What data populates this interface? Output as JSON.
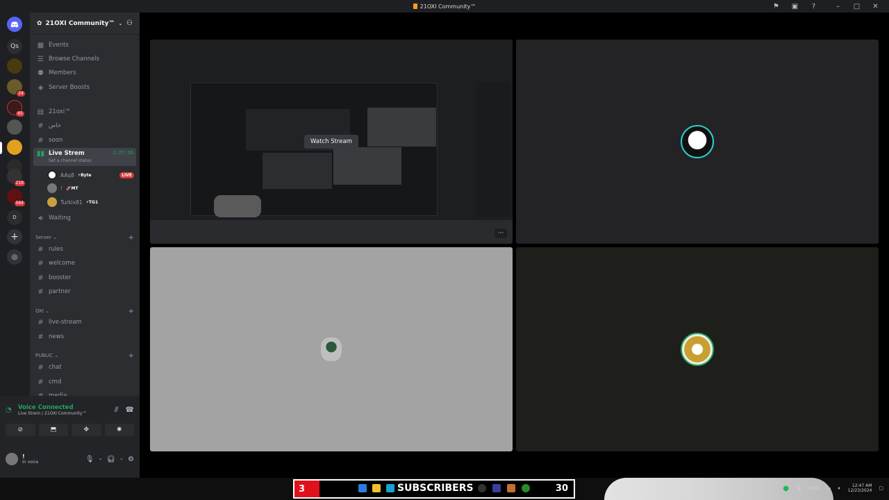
{
  "window": {
    "title": "21OXI Community™",
    "controls": [
      "flag-icon",
      "inbox-icon",
      "help-icon",
      "minimize-icon",
      "maximize-icon",
      "close-icon"
    ]
  },
  "guilds": {
    "home_label": "",
    "items": [
      {
        "label": "Qs",
        "badge": ""
      },
      {
        "label": "",
        "badge": ""
      },
      {
        "label": "",
        "badge": "24"
      },
      {
        "label": "",
        "badge": "65"
      },
      {
        "label": "",
        "badge": ""
      },
      {
        "label": "",
        "badge": ""
      },
      {
        "label": "",
        "badge": ""
      },
      {
        "label": "",
        "badge": "219"
      },
      {
        "label": "",
        "badge": "564"
      },
      {
        "label": "",
        "badge": "D"
      }
    ]
  },
  "server": {
    "name": "21OXI Community™",
    "menu": [
      {
        "label": "Events"
      },
      {
        "label": "Browse Channels"
      },
      {
        "label": "Members"
      },
      {
        "label": "Server Boosts"
      }
    ],
    "channels_top": [
      {
        "label": "21oxi™"
      },
      {
        "label": "خاص"
      },
      {
        "label": "soon"
      }
    ],
    "live_channel": {
      "label": "Live Strem",
      "timer": "2:27:16",
      "status": "Set a channel status"
    },
    "voice_users": [
      {
        "name": "AAq8",
        "tag": "Byte",
        "live": "LIVE"
      },
      {
        "name": "!",
        "tag": "MT",
        "live": ""
      },
      {
        "name": "Turkix81",
        "tag": "TG1",
        "live": ""
      }
    ],
    "waiting": "Waiting",
    "categories": [
      {
        "name": "Server",
        "channels": [
          "rules",
          "welcome",
          "booster",
          "partner"
        ]
      },
      {
        "name": "OXI",
        "channels": [
          "live-stream",
          "news"
        ]
      },
      {
        "name": "PUBLIC",
        "channels": [
          "chat",
          "cmd",
          "media"
        ]
      }
    ]
  },
  "voice_panel": {
    "status": "Voice Connected",
    "location": "Live Strem / 21OXI Community™",
    "user_name": "!",
    "user_status": "In voice"
  },
  "stage": {
    "watch_button": "Watch Stream",
    "more": "···"
  },
  "taskbar": {
    "sub_count": "3",
    "sub_label": "SUBSCRIBERS",
    "sub_goal": "30",
    "lang": "ENG",
    "time": "12:47 AM",
    "date": "12/23/2024"
  }
}
